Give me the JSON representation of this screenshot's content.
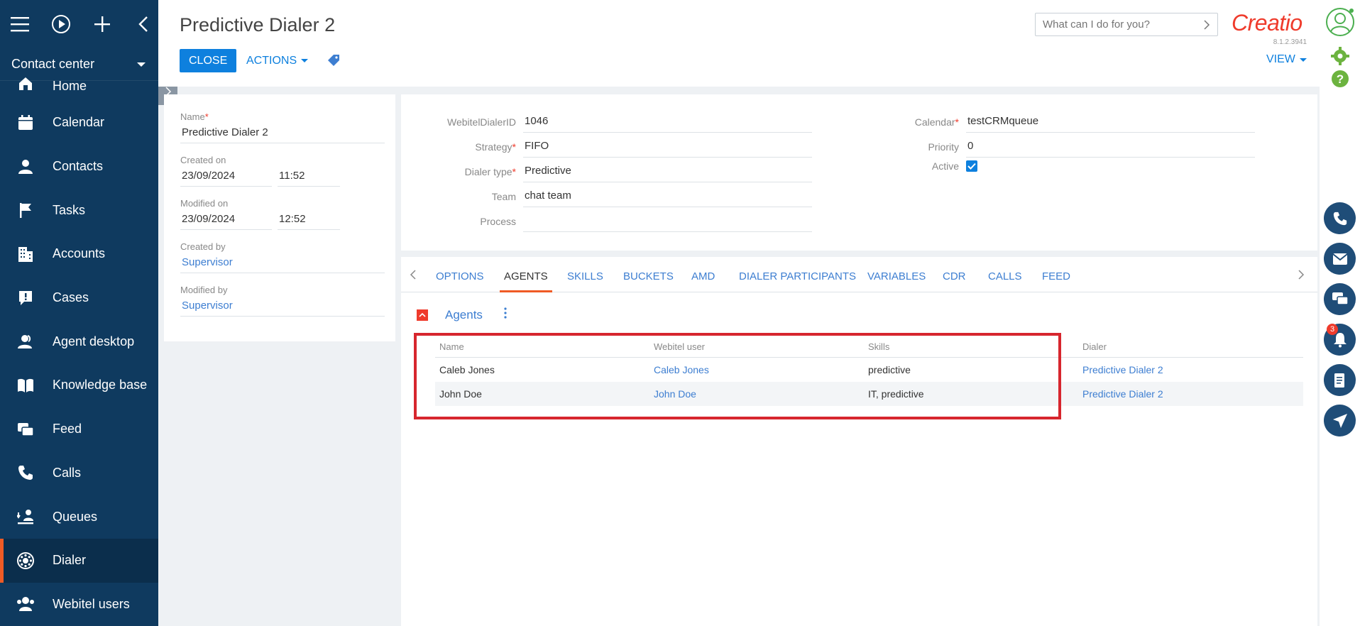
{
  "workplace": "Contact center",
  "nav": {
    "items": [
      {
        "label": "Home",
        "icon": "home-icon"
      },
      {
        "label": "Calendar",
        "icon": "calendar-icon"
      },
      {
        "label": "Contacts",
        "icon": "contact-icon"
      },
      {
        "label": "Tasks",
        "icon": "flag-icon"
      },
      {
        "label": "Accounts",
        "icon": "building-icon"
      },
      {
        "label": "Cases",
        "icon": "case-icon"
      },
      {
        "label": "Agent desktop",
        "icon": "agent-icon"
      },
      {
        "label": "Knowledge base",
        "icon": "book-icon"
      },
      {
        "label": "Feed",
        "icon": "feed-icon"
      },
      {
        "label": "Calls",
        "icon": "phone-icon"
      },
      {
        "label": "Queues",
        "icon": "queue-icon"
      },
      {
        "label": "Dialer",
        "icon": "dialer-icon"
      },
      {
        "label": "Webitel users",
        "icon": "users-icon"
      }
    ],
    "active": "Dialer"
  },
  "header": {
    "title": "Predictive Dialer 2",
    "close_label": "CLOSE",
    "actions_label": "ACTIONS",
    "view_label": "VIEW",
    "search_placeholder": "What can I do for you?",
    "logo": "Creatio",
    "version": "8.1.2.3941"
  },
  "left_card": {
    "name_label": "Name",
    "name_value": "Predictive Dialer 2",
    "created_on_label": "Created on",
    "created_date": "23/09/2024",
    "created_time": "11:52",
    "modified_on_label": "Modified on",
    "modified_date": "23/09/2024",
    "modified_time": "12:52",
    "created_by_label": "Created by",
    "created_by": "Supervisor",
    "modified_by_label": "Modified by",
    "modified_by": "Supervisor"
  },
  "fields": {
    "dialer_id_label": "WebitelDialerID",
    "dialer_id": "1046",
    "strategy_label": "Strategy",
    "strategy": "FIFO",
    "dialer_type_label": "Dialer type",
    "dialer_type": "Predictive",
    "team_label": "Team",
    "team": "chat  team",
    "process_label": "Process",
    "process": "",
    "calendar_label": "Calendar",
    "calendar": "testCRMqueue",
    "priority_label": "Priority",
    "priority": "0",
    "active_label": "Active",
    "active": true
  },
  "tabs": [
    "OPTIONS",
    "AGENTS",
    "SKILLS",
    "BUCKETS",
    "AMD",
    "DIALER PARTICIPANTS",
    "VARIABLES",
    "CDR",
    "CALLS",
    "FEED"
  ],
  "active_tab": "AGENTS",
  "agents": {
    "title": "Agents",
    "columns": [
      "Name",
      "Webitel user",
      "Skills",
      "Dialer"
    ],
    "rows": [
      {
        "name": "Caleb Jones",
        "user": "Caleb Jones",
        "skills": "predictive",
        "dialer": "Predictive Dialer 2"
      },
      {
        "name": "John Doe",
        "user": "John Doe",
        "skills": "IT, predictive",
        "dialer": "Predictive Dialer 2"
      }
    ]
  },
  "notifications_count": "3",
  "colors": {
    "sidebar": "#0f3a5f",
    "accent": "#0e80de",
    "brand": "#ef3b2c",
    "highlight": "#d7262e"
  }
}
